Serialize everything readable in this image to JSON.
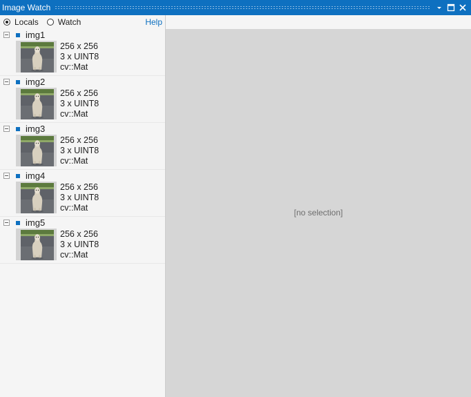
{
  "window": {
    "title": "Image Watch"
  },
  "toolbar": {
    "locals_label": "Locals",
    "watch_label": "Watch",
    "selected": "locals",
    "help_label": "Help"
  },
  "images": [
    {
      "name": "img1",
      "size": "256 x 256",
      "type": "3 x UINT8",
      "class": "cv::Mat"
    },
    {
      "name": "img2",
      "size": "256 x 256",
      "type": "3 x UINT8",
      "class": "cv::Mat"
    },
    {
      "name": "img3",
      "size": "256 x 256",
      "type": "3 x UINT8",
      "class": "cv::Mat"
    },
    {
      "name": "img4",
      "size": "256 x 256",
      "type": "3 x UINT8",
      "class": "cv::Mat"
    },
    {
      "name": "img5",
      "size": "256 x 256",
      "type": "3 x UINT8",
      "class": "cv::Mat"
    }
  ],
  "viewer": {
    "empty_text": "[no selection]"
  },
  "colors": {
    "accent": "#0e70c0",
    "viewer_bg": "#d6d6d6",
    "panel_bg": "#f5f5f5"
  }
}
